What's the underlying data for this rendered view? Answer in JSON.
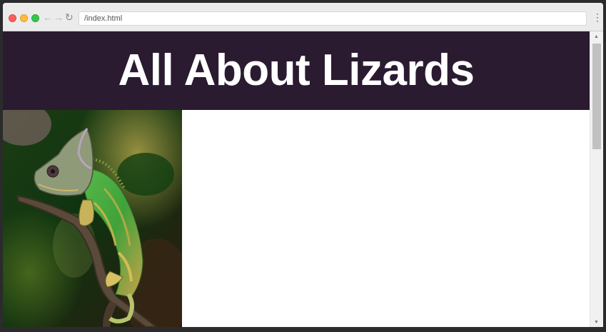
{
  "browser": {
    "address_text": "/index.html",
    "back_icon": "arrow-left-icon",
    "forward_icon": "arrow-right-icon",
    "reload_icon": "reload-icon",
    "menu_icon": "vertical-dots-icon"
  },
  "page": {
    "title": "All About Lizards",
    "header_color": "#2a1b30",
    "image_subject": "chameleon-on-branch"
  }
}
